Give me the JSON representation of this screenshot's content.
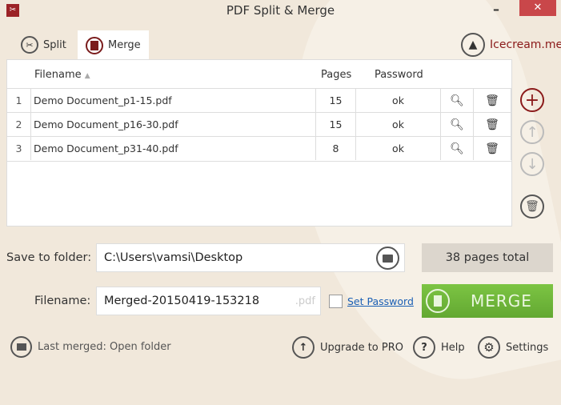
{
  "window": {
    "title": "PDF Split & Merge",
    "minimize": "–",
    "close": "✕"
  },
  "tabs": [
    {
      "label": "Split"
    },
    {
      "label": "Merge"
    }
  ],
  "brand": "Icecream.me",
  "table": {
    "headers": {
      "filename": "Filename",
      "pages": "Pages",
      "password": "Password"
    },
    "rows": [
      {
        "num": "1",
        "filename": "Demo Document_p1-15.pdf",
        "pages": "15",
        "password": "ok"
      },
      {
        "num": "2",
        "filename": "Demo Document_p16-30.pdf",
        "pages": "15",
        "password": "ok"
      },
      {
        "num": "3",
        "filename": "Demo Document_p31-40.pdf",
        "pages": "8",
        "password": "ok"
      }
    ]
  },
  "save": {
    "label": "Save to folder:",
    "value": "C:\\Users\\vamsi\\Desktop"
  },
  "total": "38 pages total",
  "filename": {
    "label": "Filename:",
    "value": "Merged-20150419-153218",
    "ext": ".pdf"
  },
  "set_password": "Set Password",
  "merge_button": "MERGE",
  "footer": {
    "last_merged": "Last merged: Open folder",
    "upgrade": "Upgrade to PRO",
    "help": "Help",
    "settings": "Settings"
  },
  "colors": {
    "accent": "#8b1a1a",
    "green": "#72b83a",
    "bg": "#f1e8db"
  }
}
